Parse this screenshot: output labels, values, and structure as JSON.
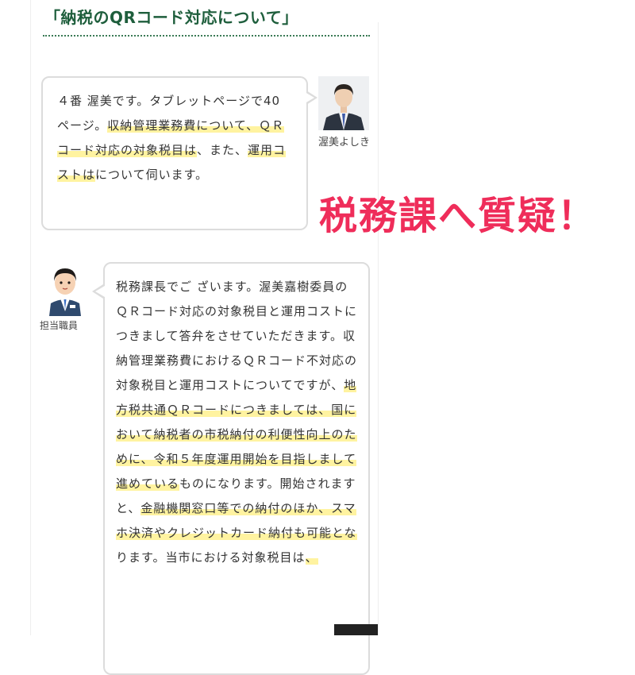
{
  "post": {
    "title": "「納税のQRコード対応について」"
  },
  "annotation": {
    "text": "税務課へ質疑！",
    "color": "#ef2d5a"
  },
  "speakers": {
    "questioner": "渥美よしき",
    "staff": "担当職員"
  },
  "icons": {
    "questioner_avatar": "photo-avatar-icon",
    "staff_avatar": "staff-avatar-icon"
  },
  "colors": {
    "title": "#1e5e3c",
    "highlight": "#fff3a0",
    "bubble_border": "#dcdcdc"
  },
  "question": {
    "segments": [
      {
        "text": "４番 渥美です。タブレットページで40 ページ。",
        "highlight": false
      },
      {
        "text": "収納管理業務費について、ＱＲコード対応の対象税目は",
        "highlight": true
      },
      {
        "text": "、また、",
        "highlight": false
      },
      {
        "text": "運用コストは",
        "highlight": true
      },
      {
        "text": "について伺います。",
        "highlight": false
      }
    ]
  },
  "answer": {
    "segments": [
      {
        "text": "税務課長でご ざいます。渥美嘉樹委員のＱＲコード対応の対象税目と運用コストにつきまして答弁をさせていただきます。収納管理業務費におけるＱＲコード不対応の対象税目と運用コストについてですが、",
        "highlight": false
      },
      {
        "text": "地方税共通ＱＲコードにつきましては、国において納税者の市税納付の利便性向上のために、令和５年度運用開始を目指しまして進めている",
        "highlight": true
      },
      {
        "text": "ものになります。開始されますと、",
        "highlight": false
      },
      {
        "text": "金融機関窓口等での納付のほか、スマホ決済やクレジットカード納付も可能とな",
        "highlight": true
      },
      {
        "text": "ります。当市における対象税目は",
        "highlight": false
      },
      {
        "text": "、",
        "highlight": true
      }
    ]
  }
}
